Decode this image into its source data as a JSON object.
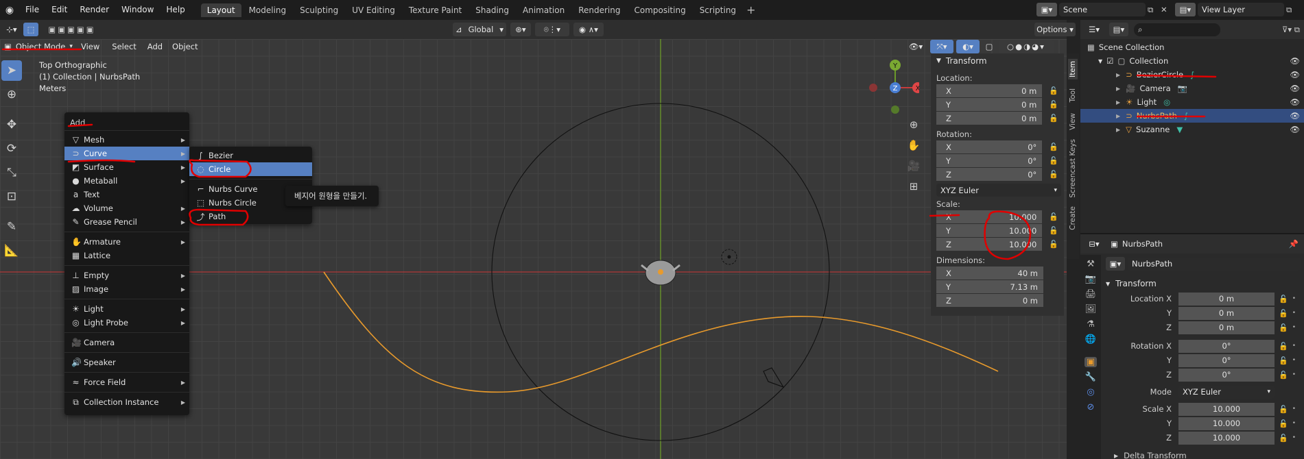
{
  "menus": [
    "File",
    "Edit",
    "Render",
    "Window",
    "Help"
  ],
  "workspaces": [
    "Layout",
    "Modeling",
    "Sculpting",
    "UV Editing",
    "Texture Paint",
    "Shading",
    "Animation",
    "Rendering",
    "Compositing",
    "Scripting"
  ],
  "active_workspace": "Layout",
  "scene": "Scene",
  "view_layer": "View Layer",
  "toolbar2": {
    "transform_orientation": "Global",
    "options": "Options"
  },
  "viewport_header": {
    "mode": "Object Mode",
    "view": "View",
    "select": "Select",
    "add": "Add",
    "object": "Object"
  },
  "overlay_text": {
    "view": "Top Orthographic",
    "collection": "(1) Collection | NurbsPath",
    "units": "Meters"
  },
  "add_menu": {
    "title": "Add",
    "items": [
      {
        "label": "Mesh",
        "icon": "mesh-icon",
        "submenu": true
      },
      {
        "label": "Curve",
        "icon": "curve-icon",
        "submenu": true,
        "highlighted": true
      },
      {
        "label": "Surface",
        "icon": "surface-icon",
        "submenu": true
      },
      {
        "label": "Metaball",
        "icon": "metaball-icon",
        "submenu": true
      },
      {
        "label": "Text",
        "icon": "text-icon",
        "submenu": false
      },
      {
        "label": "Volume",
        "icon": "volume-icon",
        "submenu": true
      },
      {
        "label": "Grease Pencil",
        "icon": "grease-pencil-icon",
        "submenu": true
      },
      {
        "label": "Armature",
        "icon": "armature-icon",
        "submenu": true
      },
      {
        "label": "Lattice",
        "icon": "lattice-icon",
        "submenu": false
      },
      {
        "label": "Empty",
        "icon": "empty-icon",
        "submenu": true
      },
      {
        "label": "Image",
        "icon": "image-icon",
        "submenu": true
      },
      {
        "label": "Light",
        "icon": "light-icon",
        "submenu": true
      },
      {
        "label": "Light Probe",
        "icon": "light-probe-icon",
        "submenu": true
      },
      {
        "label": "Camera",
        "icon": "camera-icon",
        "submenu": false
      },
      {
        "label": "Speaker",
        "icon": "speaker-icon",
        "submenu": false
      },
      {
        "label": "Force Field",
        "icon": "force-field-icon",
        "submenu": true
      },
      {
        "label": "Collection Instance",
        "icon": "collection-instance-icon",
        "submenu": true
      }
    ]
  },
  "curve_submenu": {
    "items": [
      {
        "label": "Bezier",
        "icon": "bezier-icon"
      },
      {
        "label": "Circle",
        "icon": "circle-curve-icon",
        "highlighted": true
      },
      {
        "label": "Nurbs Curve",
        "icon": "nurbs-curve-icon"
      },
      {
        "label": "Nurbs Circle",
        "icon": "nurbs-circle-icon"
      },
      {
        "label": "Path",
        "icon": "path-icon"
      }
    ]
  },
  "tooltip": "베지어 원형을 만들기.",
  "gizmo": {
    "y": "Y",
    "z": "Z",
    "x": "X"
  },
  "npanel": {
    "title": "Transform",
    "location_label": "Location:",
    "location": [
      {
        "axis": "X",
        "value": "0 m"
      },
      {
        "axis": "Y",
        "value": "0 m"
      },
      {
        "axis": "Z",
        "value": "0 m"
      }
    ],
    "rotation_label": "Rotation:",
    "rotation": [
      {
        "axis": "X",
        "value": "0°"
      },
      {
        "axis": "Y",
        "value": "0°"
      },
      {
        "axis": "Z",
        "value": "0°"
      }
    ],
    "rotation_mode": "XYZ Euler",
    "scale_label": "Scale:",
    "scale": [
      {
        "axis": "X",
        "value": "10.000"
      },
      {
        "axis": "Y",
        "value": "10.000"
      },
      {
        "axis": "Z",
        "value": "10.000"
      }
    ],
    "dimensions_label": "Dimensions:",
    "dimensions": [
      {
        "axis": "X",
        "value": "40 m"
      },
      {
        "axis": "Y",
        "value": "7.13 m"
      },
      {
        "axis": "Z",
        "value": "0 m"
      }
    ],
    "tabs": [
      "Item",
      "Tool",
      "View",
      "Screencast Keys",
      "Create"
    ]
  },
  "outliner": {
    "scene_collection": "Scene Collection",
    "collection": "Collection",
    "objects": [
      {
        "name": "BezierCircle",
        "color": "#e8a040"
      },
      {
        "name": "Camera",
        "color": "#e8a040"
      },
      {
        "name": "Light",
        "color": "#e8a040"
      },
      {
        "name": "NurbsPath",
        "color": "#e8a040",
        "selected": true
      },
      {
        "name": "Suzanne",
        "color": "#e8a040"
      }
    ]
  },
  "properties": {
    "object_name": "NurbsPath",
    "object_field": "NurbsPath",
    "section": "Transform",
    "location_x_label": "Location X",
    "rotation_x_label": "Rotation X",
    "scale_x_label": "Scale X",
    "y_label": "Y",
    "z_label": "Z",
    "location": [
      "0 m",
      "0 m",
      "0 m"
    ],
    "rotation": [
      "0°",
      "0°",
      "0°"
    ],
    "mode_label": "Mode",
    "mode": "XYZ Euler",
    "scale": [
      "10.000",
      "10.000",
      "10.000"
    ],
    "delta_transform": "Delta Transform"
  },
  "colors": {
    "accent": "#5680c2",
    "curve": "#e89a2c",
    "x_axis": "#c83c3c",
    "y_axis": "#7aa832"
  }
}
